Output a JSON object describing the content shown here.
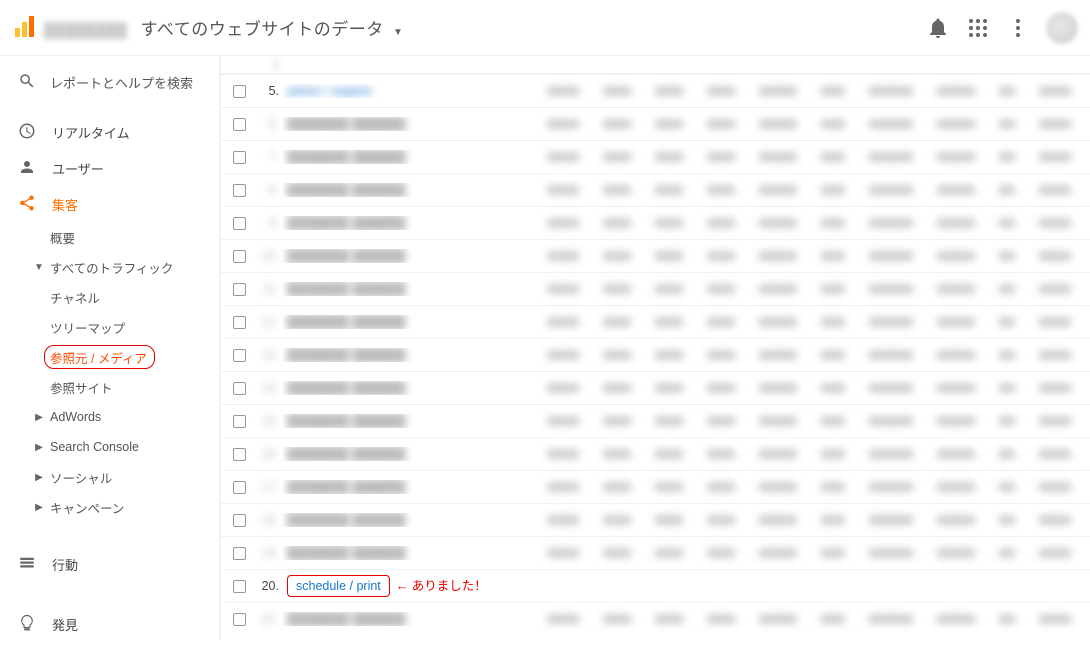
{
  "topbar": {
    "view_title": "すべてのウェブサイトのデータ"
  },
  "search": {
    "placeholder": "レポートとヘルプを検索"
  },
  "nav": {
    "realtime": "リアルタイム",
    "audience": "ユーザー",
    "acquisition": "集客",
    "acquisition_sub": {
      "overview": "概要",
      "all_traffic": "すべてのトラフィック",
      "channels": "チャネル",
      "treemaps": "ツリーマップ",
      "source_medium": "参照元 / メディア",
      "referrals": "参照サイト",
      "adwords": "AdWords",
      "search_console": "Search Console",
      "social": "ソーシャル",
      "campaigns": "キャンペーン"
    },
    "behavior": "行動",
    "conversions": "発見"
  },
  "table": {
    "rows": [
      {
        "index": "5.",
        "label": "yahoo / organic"
      },
      {
        "index": "6.",
        "label": ""
      },
      {
        "index": "7.",
        "label": ""
      },
      {
        "index": "8.",
        "label": ""
      },
      {
        "index": "9.",
        "label": ""
      },
      {
        "index": "10.",
        "label": ""
      },
      {
        "index": "11.",
        "label": ""
      },
      {
        "index": "12.",
        "label": ""
      },
      {
        "index": "13.",
        "label": ""
      },
      {
        "index": "14.",
        "label": ""
      },
      {
        "index": "15.",
        "label": ""
      },
      {
        "index": "16.",
        "label": ""
      },
      {
        "index": "17.",
        "label": ""
      },
      {
        "index": "18.",
        "label": ""
      },
      {
        "index": "19.",
        "label": ""
      },
      {
        "index": "20.",
        "label": "schedule / print",
        "highlight": true,
        "annotation": "← ありました！"
      },
      {
        "index": "21.",
        "label": ""
      }
    ]
  }
}
